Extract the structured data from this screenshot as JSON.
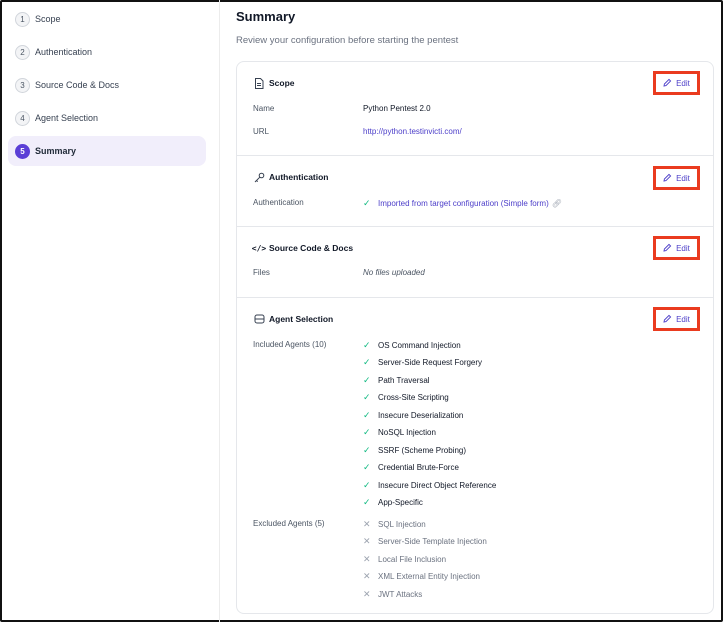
{
  "sidebar": {
    "steps": [
      {
        "num": "1",
        "label": "Scope"
      },
      {
        "num": "2",
        "label": "Authentication"
      },
      {
        "num": "3",
        "label": "Source Code & Docs"
      },
      {
        "num": "4",
        "label": "Agent Selection"
      },
      {
        "num": "5",
        "label": "Summary"
      }
    ]
  },
  "header": {
    "title": "Summary",
    "subtitle": "Review your configuration before starting the pentest"
  },
  "edit_label": "Edit",
  "scope": {
    "title": "Scope",
    "name_label": "Name",
    "name_value": "Python Pentest 2.0",
    "url_label": "URL",
    "url_value": "http://python.testinvicti.com/"
  },
  "auth": {
    "title": "Authentication",
    "label": "Authentication",
    "value": "Imported from target configuration (Simple form)"
  },
  "source": {
    "title": "Source Code & Docs",
    "files_label": "Files",
    "files_value": "No files uploaded"
  },
  "agents": {
    "title": "Agent Selection",
    "included_label": "Included Agents (10)",
    "included": [
      "OS Command Injection",
      "Server-Side Request Forgery",
      "Path Traversal",
      "Cross-Site Scripting",
      "Insecure Deserialization",
      "NoSQL Injection",
      "SSRF (Scheme Probing)",
      "Credential Brute-Force",
      "Insecure Direct Object Reference",
      "App-Specific"
    ],
    "excluded_label": "Excluded Agents (5)",
    "excluded": [
      "SQL Injection",
      "Server-Side Template Injection",
      "Local File Inclusion",
      "XML External Entity Injection",
      "JWT Attacks"
    ]
  },
  "colors": {
    "accent": "#5b3fd6",
    "link": "#4c3ec9",
    "highlight": "#ea3b1f",
    "check": "#10b981"
  }
}
